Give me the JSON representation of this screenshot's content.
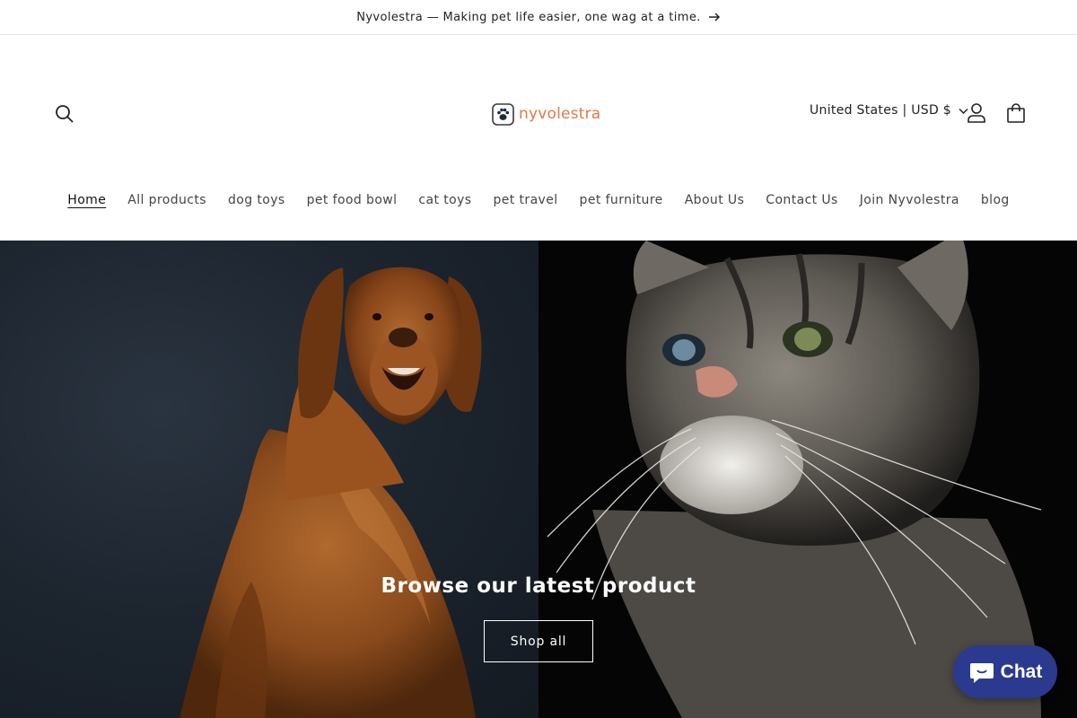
{
  "announcement": {
    "text": "Nyvolestra — Making pet life easier, one wag at a time.",
    "icon": "arrow-right-icon"
  },
  "header": {
    "logo_text": "nyvolestra",
    "locale": "United States | USD $",
    "icons": [
      "search-icon",
      "account-icon",
      "cart-icon",
      "chevron-down-icon"
    ]
  },
  "nav": {
    "items": [
      {
        "label": "Home",
        "active": true
      },
      {
        "label": "All products"
      },
      {
        "label": "dog toys"
      },
      {
        "label": "pet food bowl"
      },
      {
        "label": "cat toys"
      },
      {
        "label": "pet travel"
      },
      {
        "label": "pet furniture"
      },
      {
        "label": "About Us"
      },
      {
        "label": "Contact Us"
      },
      {
        "label": "Join Nyvolestra"
      },
      {
        "label": "blog"
      }
    ]
  },
  "hero": {
    "title": "Browse our latest product",
    "cta_label": "Shop all"
  },
  "chat": {
    "label": "Chat",
    "color": "#2b3a8f"
  },
  "colors": {
    "logo_accent": "#e07a45",
    "text": "#121212"
  }
}
